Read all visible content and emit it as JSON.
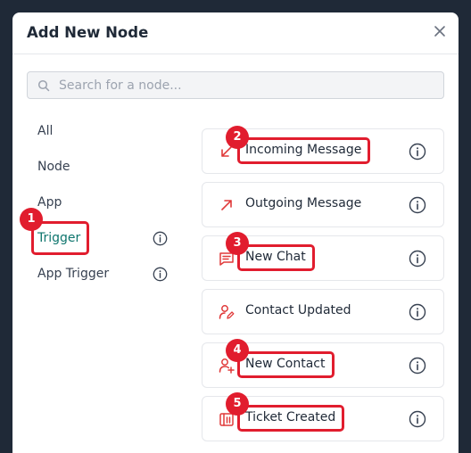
{
  "modal": {
    "title": "Add New Node",
    "search_placeholder": "Search for a node..."
  },
  "sidebar": {
    "items": [
      {
        "label": "All"
      },
      {
        "label": "Node"
      },
      {
        "label": "App"
      },
      {
        "label": "Trigger",
        "active": true
      },
      {
        "label": "App Trigger"
      }
    ]
  },
  "nodes": [
    {
      "label": "Incoming Message",
      "icon": "arrow-down-left-icon"
    },
    {
      "label": "Outgoing Message",
      "icon": "arrow-up-right-icon"
    },
    {
      "label": "New Chat",
      "icon": "chat-bubble-icon"
    },
    {
      "label": "Contact Updated",
      "icon": "user-edit-icon"
    },
    {
      "label": "New Contact",
      "icon": "user-add-icon"
    },
    {
      "label": "Ticket Created",
      "icon": "ticket-icon"
    }
  ],
  "annotations": [
    "1",
    "2",
    "3",
    "4",
    "5"
  ],
  "colors": {
    "accent": "#0f766e",
    "icon_red": "#e03a3a",
    "highlight": "#e11d2e",
    "backdrop": "#1f2937"
  }
}
